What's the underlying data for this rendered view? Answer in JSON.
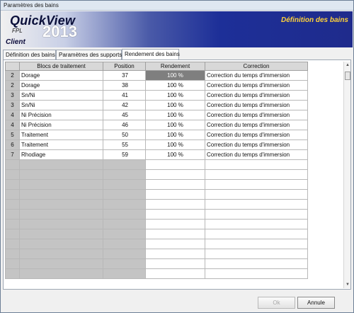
{
  "window": {
    "title": "Paramètres des bains"
  },
  "banner": {
    "brand": "QuickView",
    "fpl": "FPL",
    "year": "2013",
    "client": "Client",
    "screen_title": "Définition des bains"
  },
  "tabs": [
    {
      "label": "Définition des bains",
      "active": false
    },
    {
      "label": "Paramètres des supports",
      "active": false
    },
    {
      "label": "Rendement des bains",
      "active": true
    }
  ],
  "grid": {
    "columns": [
      "",
      "Blocs de traitement",
      "Position",
      "Rendement",
      "Correction"
    ],
    "rows": [
      {
        "num": "2",
        "bloc": "Dorage",
        "position": "37",
        "rendement": "100 %",
        "correction": "Correction du temps d'immersion",
        "selected": true
      },
      {
        "num": "2",
        "bloc": "Dorage",
        "position": "38",
        "rendement": "100 %",
        "correction": "Correction du temps d'immersion"
      },
      {
        "num": "3",
        "bloc": "Sn/Ni",
        "position": "41",
        "rendement": "100 %",
        "correction": "Correction du temps d'immersion"
      },
      {
        "num": "3",
        "bloc": "Sn/Ni",
        "position": "42",
        "rendement": "100 %",
        "correction": "Correction du temps d'immersion"
      },
      {
        "num": "4",
        "bloc": "Ni Précision",
        "position": "45",
        "rendement": "100 %",
        "correction": "Correction du temps d'immersion"
      },
      {
        "num": "4",
        "bloc": "Ni Précision",
        "position": "46",
        "rendement": "100 %",
        "correction": "Correction du temps d'immersion"
      },
      {
        "num": "5",
        "bloc": "Traitement",
        "position": "50",
        "rendement": "100 %",
        "correction": "Correction du temps d'immersion"
      },
      {
        "num": "6",
        "bloc": "Traitement",
        "position": "55",
        "rendement": "100 %",
        "correction": "Correction du temps d'immersion"
      },
      {
        "num": "7",
        "bloc": "Rhodiage",
        "position": "59",
        "rendement": "100 %",
        "correction": "Correction du temps d'immersion"
      }
    ]
  },
  "buttons": {
    "ok": "Ok",
    "cancel": "Annule"
  },
  "icons": {
    "scroll_up": "scroll-up-arrow-icon",
    "scroll_down": "scroll-down-arrow-icon"
  }
}
